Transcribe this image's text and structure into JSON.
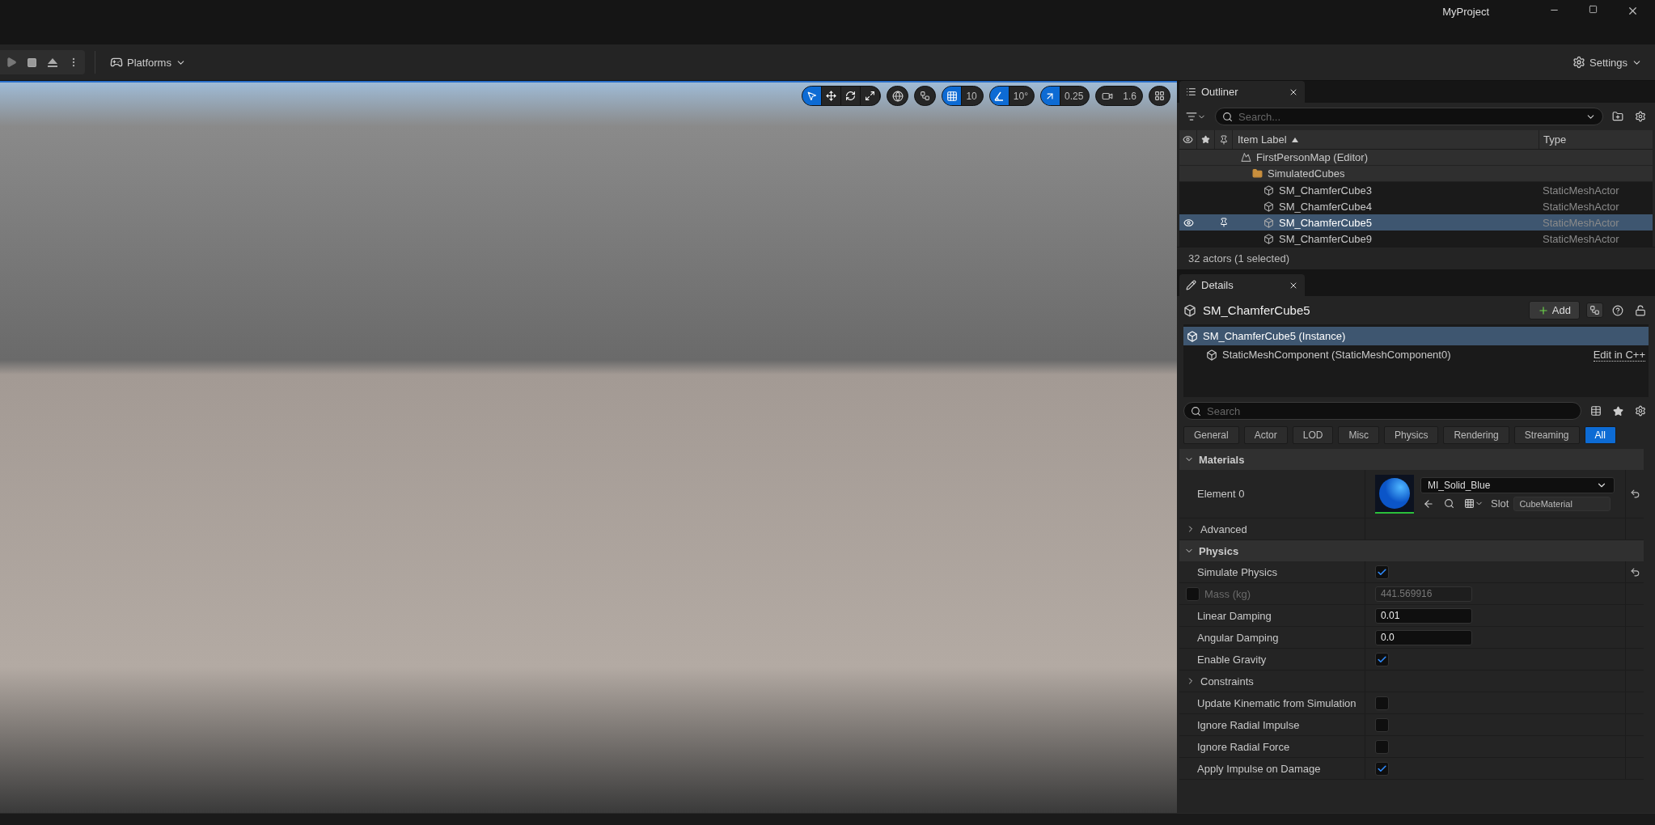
{
  "window": {
    "title": "MyProject"
  },
  "toolbar": {
    "platforms": "Platforms",
    "settings": "Settings"
  },
  "viewport_toolbar": {
    "transform_tools": [
      {
        "selected": true
      },
      {
        "selected": false
      },
      {
        "selected": false
      },
      {
        "selected": false
      }
    ],
    "grid_snap": {
      "on": true,
      "value": "10"
    },
    "rotation_snap": {
      "on": true,
      "value": "10°"
    },
    "scale_snap": {
      "on": true,
      "value": "0.25"
    },
    "camera_speed": "1.6"
  },
  "outliner": {
    "tab": "Outliner",
    "search": {
      "placeholder": "Search..."
    },
    "columns": [
      "Item Label",
      "Type"
    ],
    "tree": [
      {
        "kind": "map",
        "label": "FirstPersonMap (Editor)",
        "selected": false,
        "children": [
          {
            "kind": "folder",
            "label": "SimulatedCubes",
            "selected": false,
            "children": [
              {
                "kind": "actor",
                "label": "SM_ChamferCube3",
                "type": "StaticMeshActor",
                "selected": false
              },
              {
                "kind": "actor",
                "label": "SM_ChamferCube4",
                "type": "StaticMeshActor",
                "selected": false
              },
              {
                "kind": "actor",
                "label": "SM_ChamferCube5",
                "type": "StaticMeshActor",
                "selected": true
              },
              {
                "kind": "actor",
                "label": "SM_ChamferCube9",
                "type": "StaticMeshActor",
                "selected": false
              }
            ]
          }
        ]
      }
    ],
    "status": "32 actors (1 selected)"
  },
  "details": {
    "tab": "Details",
    "actor": "SM_ChamferCube5",
    "add": "Add",
    "components": [
      {
        "label": "SM_ChamferCube5 (Instance)",
        "selected": true,
        "children": [
          {
            "label": "StaticMeshComponent (StaticMeshComponent0)",
            "selected": false,
            "link": "Edit in C++"
          }
        ]
      }
    ],
    "search": {
      "placeholder": "Search"
    },
    "filters": [
      {
        "label": "General",
        "selected": false
      },
      {
        "label": "Actor",
        "selected": false
      },
      {
        "label": "LOD",
        "selected": false
      },
      {
        "label": "Misc",
        "selected": false
      },
      {
        "label": "Physics",
        "selected": false
      },
      {
        "label": "Rendering",
        "selected": false
      },
      {
        "label": "Streaming",
        "selected": false
      },
      {
        "label": "All",
        "selected": true
      }
    ],
    "sections": [
      {
        "title": "Materials",
        "expanded": true,
        "rows": [
          {
            "kind": "material",
            "label": "Element 0",
            "value": "MI_Solid_Blue",
            "slot_label": "Slot",
            "slot": "CubeMaterial",
            "reset": true
          },
          {
            "kind": "group",
            "label": "Advanced",
            "expanded": false
          }
        ]
      },
      {
        "title": "Physics",
        "expanded": true,
        "rows": [
          {
            "kind": "checkbox",
            "label": "Simulate Physics",
            "checked": true,
            "reset": true
          },
          {
            "kind": "override",
            "label": "Mass (kg)",
            "checked": false,
            "value": "441.569916",
            "disabled": true
          },
          {
            "kind": "number",
            "label": "Linear Damping",
            "value": "0.01"
          },
          {
            "kind": "number",
            "label": "Angular Damping",
            "value": "0.0"
          },
          {
            "kind": "checkbox",
            "label": "Enable Gravity",
            "checked": true
          },
          {
            "kind": "group",
            "label": "Constraints",
            "expanded": false
          },
          {
            "kind": "checkbox",
            "label": "Update Kinematic from Simulation",
            "checked": false
          },
          {
            "kind": "checkbox",
            "label": "Ignore Radial Impulse",
            "checked": false
          },
          {
            "kind": "checkbox",
            "label": "Ignore Radial Force",
            "checked": false
          },
          {
            "kind": "checkbox",
            "label": "Apply Impulse on Damage",
            "checked": true
          }
        ]
      }
    ]
  }
}
